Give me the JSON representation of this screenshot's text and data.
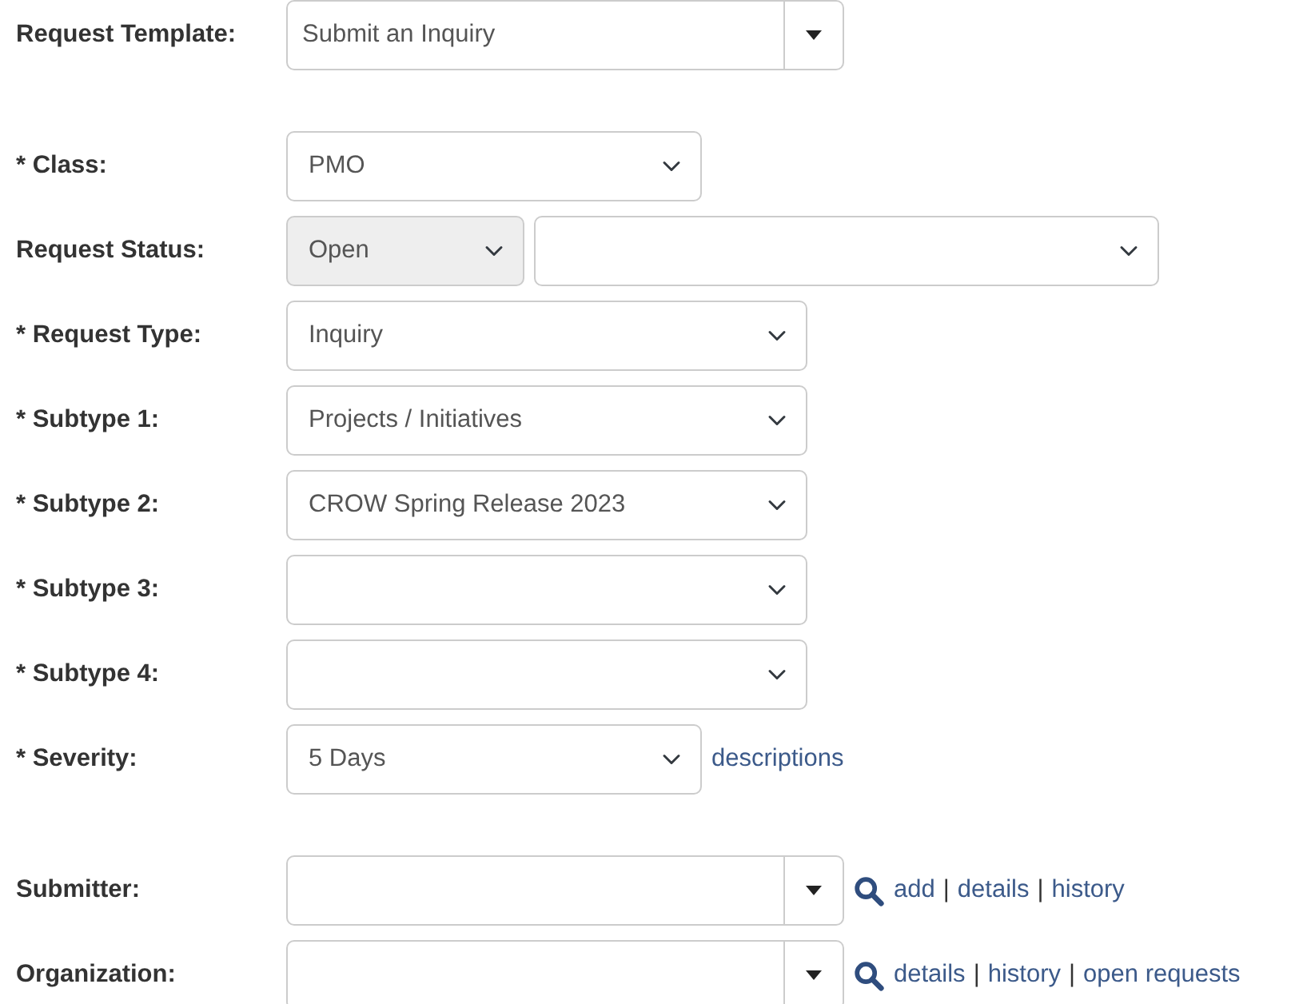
{
  "sections": [
    {
      "fields": [
        {
          "kind": "combo",
          "label": "Request Template:",
          "value": "Submit an Inquiry"
        }
      ]
    },
    {
      "fields": [
        {
          "kind": "short-select",
          "label": "* Class:",
          "value": "PMO"
        },
        {
          "kind": "select-pair",
          "label": "Request Status:",
          "value": "Open",
          "disabled": true
        },
        {
          "kind": "select",
          "label": "* Request Type:",
          "value": "Inquiry"
        },
        {
          "kind": "select",
          "label": "* Subtype 1:",
          "value": "Projects / Initiatives"
        },
        {
          "kind": "select",
          "label": "* Subtype 2:",
          "value": "CROW Spring Release 2023"
        },
        {
          "kind": "select",
          "label": "* Subtype 3:"
        },
        {
          "kind": "select",
          "label": "* Subtype 4:"
        },
        {
          "kind": "short-select",
          "label": "* Severity:",
          "value": "5 Days",
          "links": [
            {
              "kind": "link",
              "text": "descriptions"
            }
          ]
        }
      ]
    },
    {
      "fields": [
        {
          "kind": "lookup",
          "label": "Submitter:",
          "links": [
            {
              "kind": "link",
              "text": "add"
            },
            {
              "kind": "separator",
              "text": "|"
            },
            {
              "kind": "link",
              "text": "details"
            },
            {
              "kind": "separator",
              "text": "|"
            },
            {
              "kind": "link",
              "text": "history"
            }
          ]
        },
        {
          "kind": "lookup",
          "label": "Organization:",
          "links": [
            {
              "kind": "link",
              "text": "details"
            },
            {
              "kind": "separator",
              "text": "|"
            },
            {
              "kind": "link",
              "text": "history"
            },
            {
              "kind": "separator",
              "text": "|"
            },
            {
              "kind": "link",
              "text": "open requests"
            }
          ]
        }
      ]
    }
  ]
}
